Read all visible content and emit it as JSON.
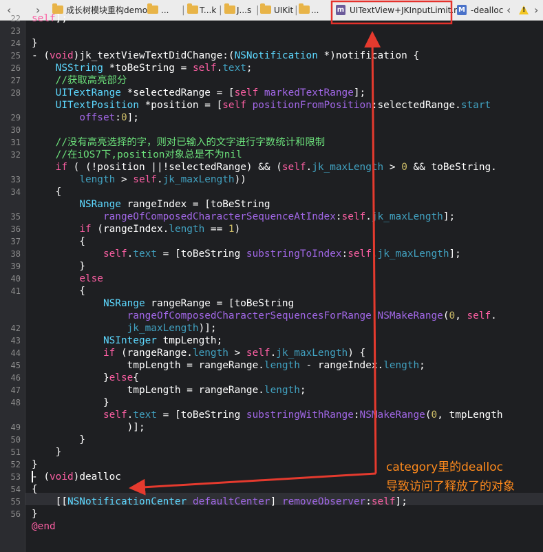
{
  "jump_bar": {
    "nav_back": "‹",
    "nav_forward": "›",
    "breadcrumbs": [
      "成长树模块重构demo",
      "...",
      "T...k",
      "J...s",
      "UIKit",
      "..."
    ],
    "active_file": "UITextView+JKInputLimit.m",
    "file_icon_letter": "m",
    "method_icon_letter": "M",
    "method": "-dealloc",
    "colors": {
      "highlight_box": "#e5312b",
      "arrow": "#e53a2e",
      "annotation": "#ff8a1c"
    }
  },
  "editor": {
    "line_numbers": [
      "22",
      "23",
      "24",
      "25",
      "26",
      "27",
      "28",
      "",
      "29",
      "30",
      "31",
      "32",
      "",
      "33",
      "34",
      "",
      "35",
      "36",
      "37",
      "38",
      "39",
      "40",
      "41",
      "",
      "",
      "42",
      "43",
      "44",
      "45",
      "46",
      "47",
      "48",
      "",
      "49",
      "50",
      "51",
      "52",
      "53",
      "54",
      "55",
      "56"
    ],
    "lines": [
      [
        {
          "t": "self",
          "c": "kw"
        },
        {
          "t": "];",
          "c": ""
        }
      ],
      [
        {
          "t": "",
          "c": ""
        }
      ],
      [
        {
          "t": "}",
          "c": ""
        }
      ],
      [
        {
          "t": "- (",
          "c": ""
        },
        {
          "t": "void",
          "c": "kw"
        },
        {
          "t": ")jk_textViewTextDidChange:(",
          "c": ""
        },
        {
          "t": "NSNotification",
          "c": "ty"
        },
        {
          "t": " *)notification {",
          "c": ""
        }
      ],
      [
        {
          "t": "    ",
          "c": ""
        },
        {
          "t": "NSString",
          "c": "ty"
        },
        {
          "t": " *toBeString = ",
          "c": ""
        },
        {
          "t": "self",
          "c": "kw"
        },
        {
          "t": ".",
          "c": ""
        },
        {
          "t": "text",
          "c": "pr"
        },
        {
          "t": ";",
          "c": ""
        }
      ],
      [
        {
          "t": "    ",
          "c": ""
        },
        {
          "t": "//获取高亮部分",
          "c": "cm"
        }
      ],
      [
        {
          "t": "    ",
          "c": ""
        },
        {
          "t": "UITextRange",
          "c": "ty"
        },
        {
          "t": " *selectedRange = [",
          "c": ""
        },
        {
          "t": "self",
          "c": "kw"
        },
        {
          "t": " ",
          "c": ""
        },
        {
          "t": "markedTextRange",
          "c": "me"
        },
        {
          "t": "];",
          "c": ""
        }
      ],
      [
        {
          "t": "    ",
          "c": ""
        },
        {
          "t": "UITextPosition",
          "c": "ty"
        },
        {
          "t": " *position = [",
          "c": ""
        },
        {
          "t": "self",
          "c": "kw"
        },
        {
          "t": " ",
          "c": ""
        },
        {
          "t": "positionFromPosition",
          "c": "me"
        },
        {
          "t": ":selectedRange.",
          "c": ""
        },
        {
          "t": "start",
          "c": "pr"
        }
      ],
      [
        {
          "t": "        ",
          "c": ""
        },
        {
          "t": "offset",
          "c": "me"
        },
        {
          "t": ":",
          "c": ""
        },
        {
          "t": "0",
          "c": "nu"
        },
        {
          "t": "];",
          "c": ""
        }
      ],
      [
        {
          "t": "",
          "c": ""
        }
      ],
      [
        {
          "t": "    ",
          "c": ""
        },
        {
          "t": "//没有高亮选择的字，则对已输入的文字进行字数统计和限制",
          "c": "cm"
        }
      ],
      [
        {
          "t": "    ",
          "c": ""
        },
        {
          "t": "//在iOS7下,position对象总是不为nil",
          "c": "cm"
        }
      ],
      [
        {
          "t": "    ",
          "c": ""
        },
        {
          "t": "if",
          "c": "kw"
        },
        {
          "t": " ( (!position ||!selectedRange) && (",
          "c": ""
        },
        {
          "t": "self",
          "c": "kw"
        },
        {
          "t": ".",
          "c": ""
        },
        {
          "t": "jk_maxLength",
          "c": "pr"
        },
        {
          "t": " > ",
          "c": ""
        },
        {
          "t": "0",
          "c": "nu"
        },
        {
          "t": " && toBeString.",
          "c": ""
        }
      ],
      [
        {
          "t": "        ",
          "c": ""
        },
        {
          "t": "length",
          "c": "pr"
        },
        {
          "t": " > ",
          "c": ""
        },
        {
          "t": "self",
          "c": "kw"
        },
        {
          "t": ".",
          "c": ""
        },
        {
          "t": "jk_maxLength",
          "c": "pr"
        },
        {
          "t": "))",
          "c": ""
        }
      ],
      [
        {
          "t": "    {",
          "c": ""
        }
      ],
      [
        {
          "t": "        ",
          "c": ""
        },
        {
          "t": "NSRange",
          "c": "ty"
        },
        {
          "t": " rangeIndex = [toBeString",
          "c": ""
        }
      ],
      [
        {
          "t": "            ",
          "c": ""
        },
        {
          "t": "rangeOfComposedCharacterSequenceAtIndex",
          "c": "me"
        },
        {
          "t": ":",
          "c": ""
        },
        {
          "t": "self",
          "c": "kw"
        },
        {
          "t": ".",
          "c": ""
        },
        {
          "t": "jk_maxLength",
          "c": "pr"
        },
        {
          "t": "];",
          "c": ""
        }
      ],
      [
        {
          "t": "        ",
          "c": ""
        },
        {
          "t": "if",
          "c": "kw"
        },
        {
          "t": " (rangeIndex.",
          "c": ""
        },
        {
          "t": "length",
          "c": "pr"
        },
        {
          "t": " == ",
          "c": ""
        },
        {
          "t": "1",
          "c": "nu"
        },
        {
          "t": ")",
          "c": ""
        }
      ],
      [
        {
          "t": "        {",
          "c": ""
        }
      ],
      [
        {
          "t": "            ",
          "c": ""
        },
        {
          "t": "self",
          "c": "kw"
        },
        {
          "t": ".",
          "c": ""
        },
        {
          "t": "text",
          "c": "pr"
        },
        {
          "t": " = [toBeString ",
          "c": ""
        },
        {
          "t": "substringToIndex",
          "c": "me"
        },
        {
          "t": ":",
          "c": ""
        },
        {
          "t": "self",
          "c": "kw"
        },
        {
          "t": ".",
          "c": ""
        },
        {
          "t": "jk_maxLength",
          "c": "pr"
        },
        {
          "t": "];",
          "c": ""
        }
      ],
      [
        {
          "t": "        }",
          "c": ""
        }
      ],
      [
        {
          "t": "        ",
          "c": ""
        },
        {
          "t": "else",
          "c": "kw"
        }
      ],
      [
        {
          "t": "        {",
          "c": ""
        }
      ],
      [
        {
          "t": "            ",
          "c": ""
        },
        {
          "t": "NSRange",
          "c": "ty"
        },
        {
          "t": " rangeRange = [toBeString",
          "c": ""
        }
      ],
      [
        {
          "t": "                ",
          "c": ""
        },
        {
          "t": "rangeOfComposedCharacterSequencesForRange",
          "c": "me"
        },
        {
          "t": ":",
          "c": ""
        },
        {
          "t": "NSMakeRange",
          "c": "me"
        },
        {
          "t": "(",
          "c": ""
        },
        {
          "t": "0",
          "c": "nu"
        },
        {
          "t": ", ",
          "c": ""
        },
        {
          "t": "self",
          "c": "kw"
        },
        {
          "t": ".",
          "c": ""
        }
      ],
      [
        {
          "t": "                ",
          "c": ""
        },
        {
          "t": "jk_maxLength",
          "c": "pr"
        },
        {
          "t": ")];",
          "c": ""
        }
      ],
      [
        {
          "t": "            ",
          "c": ""
        },
        {
          "t": "NSInteger",
          "c": "ty"
        },
        {
          "t": " tmpLength;",
          "c": ""
        }
      ],
      [
        {
          "t": "            ",
          "c": ""
        },
        {
          "t": "if",
          "c": "kw"
        },
        {
          "t": " (rangeRange.",
          "c": ""
        },
        {
          "t": "length",
          "c": "pr"
        },
        {
          "t": " > ",
          "c": ""
        },
        {
          "t": "self",
          "c": "kw"
        },
        {
          "t": ".",
          "c": ""
        },
        {
          "t": "jk_maxLength",
          "c": "pr"
        },
        {
          "t": ") {",
          "c": ""
        }
      ],
      [
        {
          "t": "                tmpLength = rangeRange.",
          "c": ""
        },
        {
          "t": "length",
          "c": "pr"
        },
        {
          "t": " - rangeIndex.",
          "c": ""
        },
        {
          "t": "length",
          "c": "pr"
        },
        {
          "t": ";",
          "c": ""
        }
      ],
      [
        {
          "t": "            }",
          "c": ""
        },
        {
          "t": "else",
          "c": "kw"
        },
        {
          "t": "{",
          "c": ""
        }
      ],
      [
        {
          "t": "                tmpLength = rangeRange.",
          "c": ""
        },
        {
          "t": "length",
          "c": "pr"
        },
        {
          "t": ";",
          "c": ""
        }
      ],
      [
        {
          "t": "            }",
          "c": ""
        }
      ],
      [
        {
          "t": "            ",
          "c": ""
        },
        {
          "t": "self",
          "c": "kw"
        },
        {
          "t": ".",
          "c": ""
        },
        {
          "t": "text",
          "c": "pr"
        },
        {
          "t": " = [toBeString ",
          "c": ""
        },
        {
          "t": "substringWithRange",
          "c": "me"
        },
        {
          "t": ":",
          "c": ""
        },
        {
          "t": "NSMakeRange",
          "c": "me"
        },
        {
          "t": "(",
          "c": ""
        },
        {
          "t": "0",
          "c": "nu"
        },
        {
          "t": ", tmpLength",
          "c": ""
        }
      ],
      [
        {
          "t": "                )];",
          "c": ""
        }
      ],
      [
        {
          "t": "        }",
          "c": ""
        }
      ],
      [
        {
          "t": "    }",
          "c": ""
        }
      ],
      [
        {
          "t": "}",
          "c": ""
        }
      ],
      [
        {
          "t": "- (",
          "c": ""
        },
        {
          "t": "void",
          "c": "kw"
        },
        {
          "t": ")dealloc",
          "c": ""
        }
      ],
      [
        {
          "t": "{",
          "c": ""
        }
      ],
      [
        {
          "t": "    [[",
          "c": ""
        },
        {
          "t": "NSNotificationCenter",
          "c": "ty"
        },
        {
          "t": " ",
          "c": ""
        },
        {
          "t": "defaultCenter",
          "c": "me"
        },
        {
          "t": "] ",
          "c": ""
        },
        {
          "t": "removeObserver",
          "c": "me"
        },
        {
          "t": ":",
          "c": ""
        },
        {
          "t": "self",
          "c": "kw"
        },
        {
          "t": "];",
          "c": ""
        }
      ],
      [
        {
          "t": "}",
          "c": ""
        }
      ],
      [
        {
          "t": "@end",
          "c": "kw"
        }
      ]
    ]
  },
  "annotation": {
    "line1": "category里的dealloc",
    "line2": "导致访问了释放了的对象"
  }
}
